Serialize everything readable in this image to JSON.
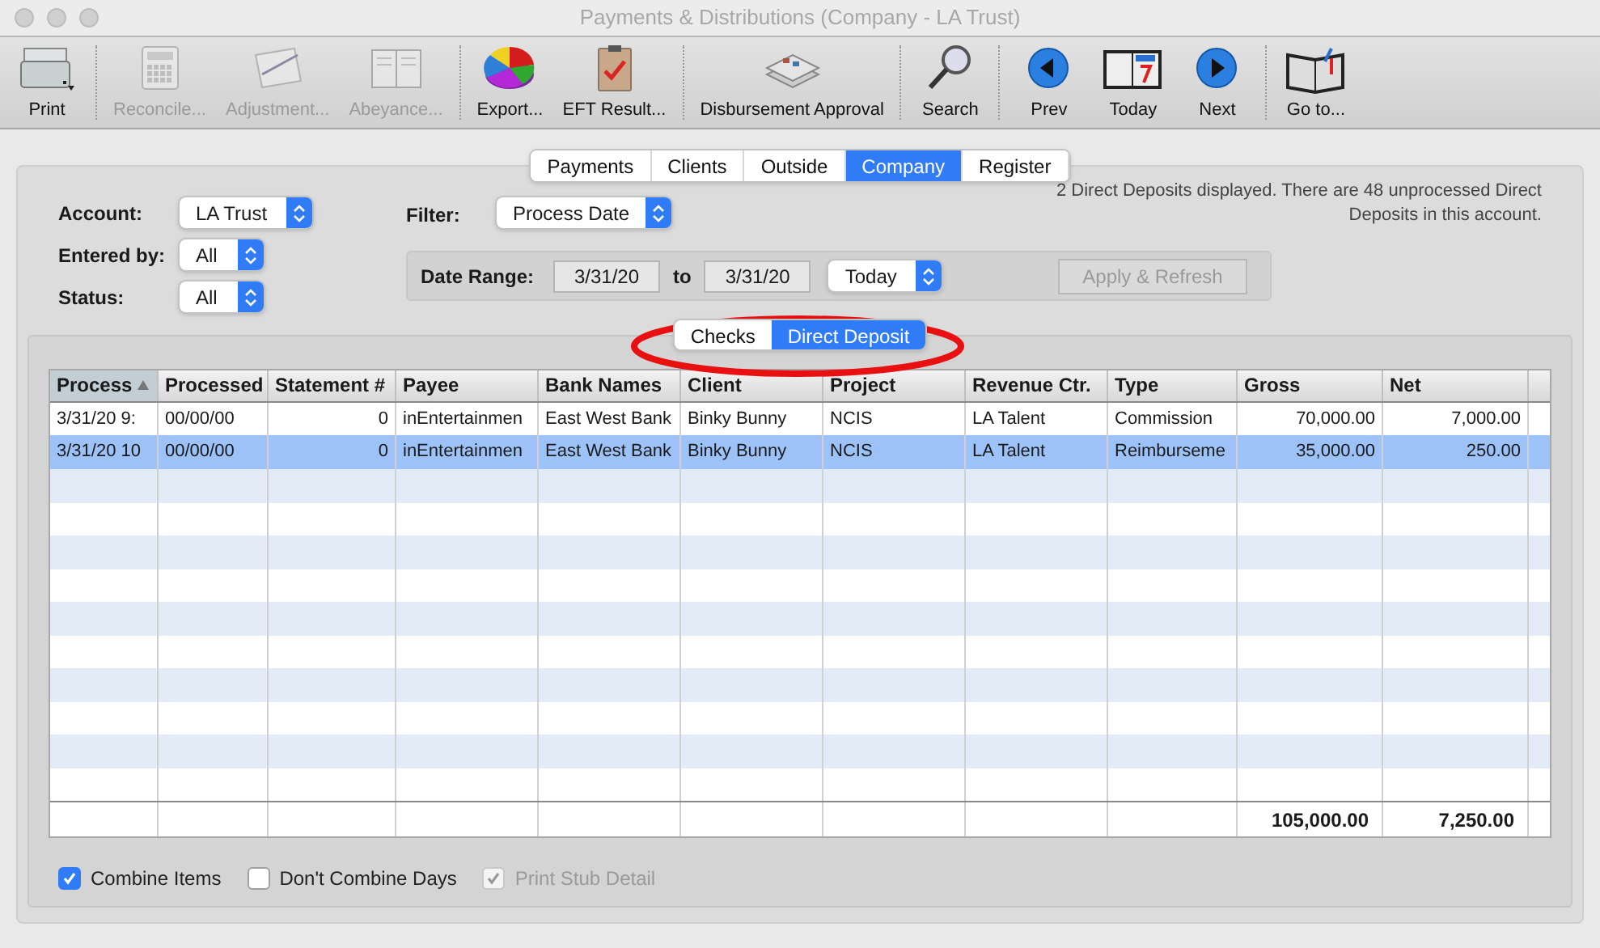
{
  "window": {
    "title": "Payments & Distributions (Company - LA Trust)"
  },
  "toolbar": [
    [
      {
        "label": "Print",
        "disabled": false
      }
    ],
    [
      {
        "label": "Reconcile...",
        "disabled": true
      },
      {
        "label": "Adjustment...",
        "disabled": true
      },
      {
        "label": "Abeyance...",
        "disabled": true
      }
    ],
    [
      {
        "label": "Export...",
        "disabled": false
      },
      {
        "label": "EFT Result...",
        "disabled": false
      }
    ],
    [
      {
        "label": "Disbursement Approval",
        "disabled": false
      }
    ],
    [
      {
        "label": "Search",
        "disabled": false
      }
    ],
    [
      {
        "label": "Prev",
        "disabled": false
      },
      {
        "label": "Today",
        "disabled": false
      },
      {
        "label": "Next",
        "disabled": false
      }
    ],
    [
      {
        "label": "Go to...",
        "disabled": false
      }
    ]
  ],
  "tabs": [
    {
      "label": "Payments",
      "selected": false
    },
    {
      "label": "Clients",
      "selected": false
    },
    {
      "label": "Outside",
      "selected": false
    },
    {
      "label": "Company",
      "selected": true
    },
    {
      "label": "Register",
      "selected": false
    }
  ],
  "form": {
    "account": {
      "label": "Account:",
      "value": "LA Trust"
    },
    "entered_by": {
      "label": "Entered by:",
      "value": "All"
    },
    "status": {
      "label": "Status:",
      "value": "All"
    },
    "filter": {
      "label": "Filter:",
      "value": "Process Date"
    },
    "date_range": {
      "label": "Date Range:",
      "from": "3/31/20",
      "to_label": "to",
      "to": "3/31/20",
      "preset": "Today",
      "apply_button": "Apply & Refresh",
      "apply_disabled": true
    },
    "summary": "2 Direct Deposits displayed. There are 48 unprocessed Direct Deposits in this account."
  },
  "subtabs": [
    {
      "label": "Checks",
      "selected": false
    },
    {
      "label": "Direct Deposit",
      "selected": true
    }
  ],
  "table": {
    "columns": [
      {
        "label": "Process",
        "sorted": true
      },
      {
        "label": "Processed",
        "sorted": false
      },
      {
        "label": "Statement #",
        "sorted": false
      },
      {
        "label": "Payee",
        "sorted": false
      },
      {
        "label": "Bank Names",
        "sorted": false
      },
      {
        "label": "Client",
        "sorted": false
      },
      {
        "label": "Project",
        "sorted": false
      },
      {
        "label": "Revenue Ctr.",
        "sorted": false
      },
      {
        "label": "Type",
        "sorted": false
      },
      {
        "label": "Gross",
        "sorted": false
      },
      {
        "label": "Net",
        "sorted": false
      }
    ],
    "rows": [
      {
        "selected": false,
        "cells": [
          "3/31/20 9:",
          "00/00/00",
          "0",
          "inEntertainmen",
          "East West Bank",
          "Binky Bunny",
          "NCIS",
          "LA Talent",
          "Commission",
          "70,000.00",
          "7,000.00"
        ]
      },
      {
        "selected": true,
        "cells": [
          "3/31/20 10",
          "00/00/00",
          "0",
          "inEntertainmen",
          "East West Bank",
          "Binky Bunny",
          "NCIS",
          "LA Talent",
          "Reimburseme",
          "35,000.00",
          "250.00"
        ]
      }
    ],
    "totals": {
      "gross": "105,000.00",
      "net": "7,250.00"
    }
  },
  "options": [
    {
      "label": "Combine Items",
      "checked": true,
      "disabled": false
    },
    {
      "label": "Don't Combine Days",
      "checked": false,
      "disabled": false
    },
    {
      "label": "Print Stub Detail",
      "checked": true,
      "disabled": true
    }
  ]
}
